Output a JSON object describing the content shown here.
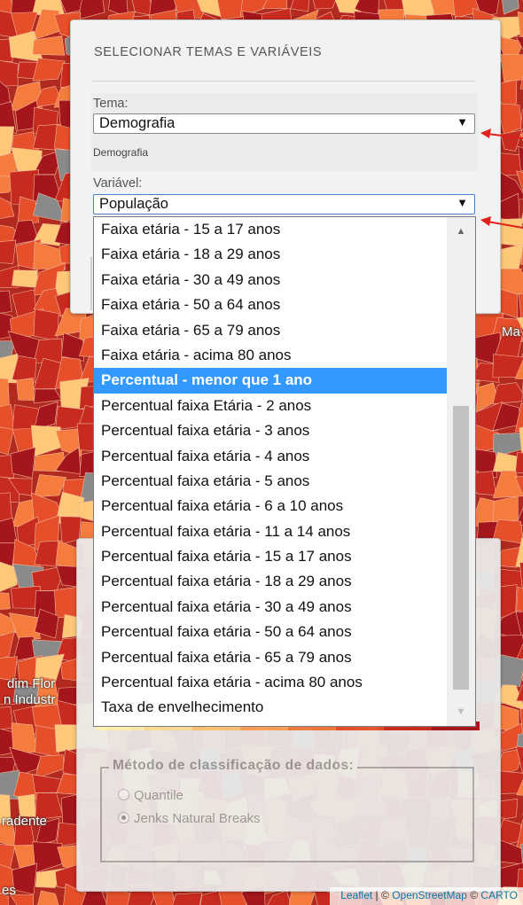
{
  "panel": {
    "title": "SELECIONAR TEMAS E VARIÁVEIS",
    "tema_label": "Tema:",
    "tema_value": "Demografia",
    "tema_caption": "Demografia",
    "variavel_label": "Variável:",
    "variavel_value": "População",
    "arrow_symbol": "▼"
  },
  "dropdown": {
    "options": [
      "Faixa etária - 15 a 17 anos",
      "Faixa etária - 18 a 29 anos",
      "Faixa etária - 30 a 49 anos",
      "Faixa etária - 50 a 64 anos",
      "Faixa etária - 65 a 79 anos",
      "Faixa etária - acima 80 anos",
      "Percentual - menor que 1 ano",
      "Percentual faixa Etária - 2 anos",
      "Percentual faixa etária - 3 anos",
      "Percentual faixa etária - 4 anos",
      "Percentual faixa etária - 5 anos",
      "Percentual faixa etária - 6 a 10 anos",
      "Percentual faixa etária - 11 a 14 anos",
      "Percentual faixa etária - 15 a 17 anos",
      "Percentual faixa etária - 18 a 29 anos",
      "Percentual faixa etária - 30 a 49 anos",
      "Percentual faixa etária - 50 a 64 anos",
      "Percentual faixa etária - 65 a 79 anos",
      "Percentual faixa etária - acima 80 anos",
      "Taxa de envelhecimento"
    ],
    "selected_index": 6,
    "highlight_color": "#3399ff"
  },
  "classification": {
    "legend": "Método de classificação de dados:",
    "options": [
      "Quantile",
      "Jenks Natural Breaks"
    ],
    "selected_index": 1
  },
  "color_ramp": [
    "#fff5b8",
    "#fde49a",
    "#fdc978",
    "#fca55a",
    "#f57c3d",
    "#e54f2a",
    "#c72a1f",
    "#a4161b"
  ],
  "map_labels": {
    "left_1": "dim Flor",
    "left_2": "n Industr",
    "left_3": "radente",
    "left_4": "es",
    "right_1": "Ma"
  },
  "attribution": {
    "leaflet": "Leaflet",
    "sep": " | © ",
    "osm": "OpenStreetMap",
    "sep2": " © ",
    "carto": "CARTO"
  },
  "colors": {
    "map_base": "#b1291f",
    "arrow": "#e0201b"
  }
}
